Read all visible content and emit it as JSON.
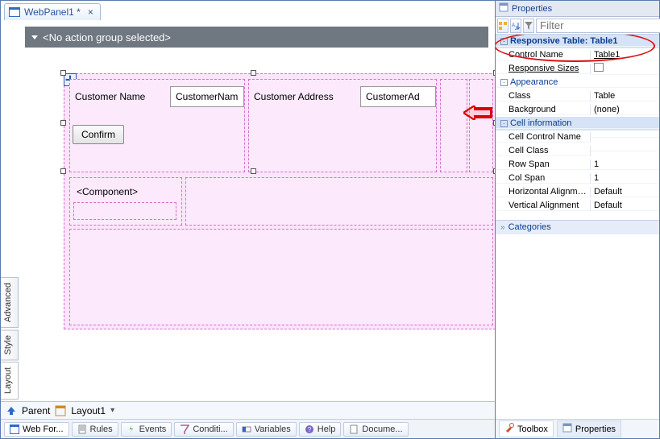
{
  "tab": {
    "title": "WebPanel1 *"
  },
  "actiongroup": {
    "text": "<No action group selected>"
  },
  "designer": {
    "label_customer_name": "Customer Name",
    "field_customer_name": "CustomerNam",
    "label_customer_address": "Customer Address",
    "field_customer_address": "CustomerAd",
    "confirm": "Confirm",
    "component": "<Component>"
  },
  "vtabs": {
    "advanced": "Advanced",
    "style": "Style",
    "layout": "Layout"
  },
  "breadcrumb": {
    "parent": "Parent",
    "layout": "Layout1"
  },
  "bottomtabs": {
    "webform": "Web For...",
    "rules": "Rules",
    "events": "Events",
    "conditions": "Conditi...",
    "variables": "Variables",
    "help": "Help",
    "docume": "Docume..."
  },
  "right": {
    "header": "Properties",
    "filter_placeholder": "Filter",
    "category_top": "Responsive Table: Table1",
    "rows": {
      "control_name": {
        "k": "Control Name",
        "v": "Table1"
      },
      "responsive_sizes": {
        "k": "Responsive Sizes",
        "v": ""
      },
      "appearance": "Appearance",
      "class": {
        "k": "Class",
        "v": "Table"
      },
      "background": {
        "k": "Background",
        "v": "(none)"
      },
      "cell_info": "Cell information",
      "cell_control_name": {
        "k": "Cell Control Name",
        "v": ""
      },
      "cell_class": {
        "k": "Cell Class",
        "v": ""
      },
      "row_span": {
        "k": "Row Span",
        "v": "1"
      },
      "col_span": {
        "k": "Col Span",
        "v": "1"
      },
      "h_align": {
        "k": "Horizontal Alignment",
        "v": "Default"
      },
      "v_align": {
        "k": "Vertical Alignment",
        "v": "Default"
      }
    },
    "categories": "Categories",
    "toolbox": "Toolbox",
    "properties": "Properties"
  }
}
